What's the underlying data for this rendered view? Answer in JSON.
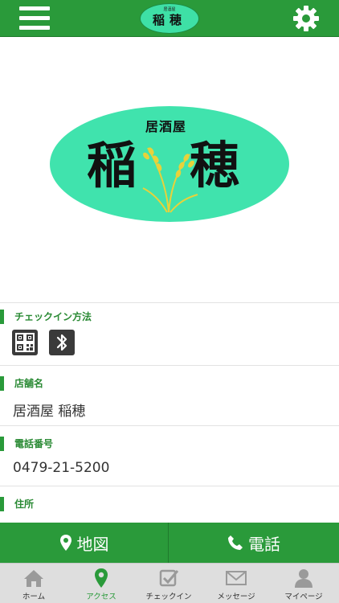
{
  "header": {
    "menu_icon": "hamburger-menu-icon",
    "logo_sub": "居酒屋",
    "logo_main": "稲穂",
    "settings_icon": "gear-icon"
  },
  "hero": {
    "sub": "居酒屋",
    "kanji_1": "稲",
    "kanji_2": "穂",
    "background_color": "#40e3ad"
  },
  "sections": {
    "checkin": {
      "title": "チェックイン方法",
      "icons": [
        "qr-code-icon",
        "bluetooth-icon"
      ]
    },
    "store": {
      "title": "店舗名",
      "value": "居酒屋 稲穂"
    },
    "phone": {
      "title": "電話番号",
      "value": "0479-21-5200"
    },
    "address": {
      "title": "住所"
    }
  },
  "actions": {
    "map_label": "地図",
    "tel_label": "電話"
  },
  "tabs": [
    {
      "label": "ホーム",
      "icon": "home-icon"
    },
    {
      "label": "アクセス",
      "icon": "map-pin-icon",
      "active": true
    },
    {
      "label": "チェックイン",
      "icon": "checkin-icon"
    },
    {
      "label": "メッセージ",
      "icon": "envelope-icon"
    },
    {
      "label": "マイページ",
      "icon": "person-icon"
    }
  ],
  "colors": {
    "brand_green": "#2a9a3a",
    "logo_mint": "#40e3ad"
  }
}
